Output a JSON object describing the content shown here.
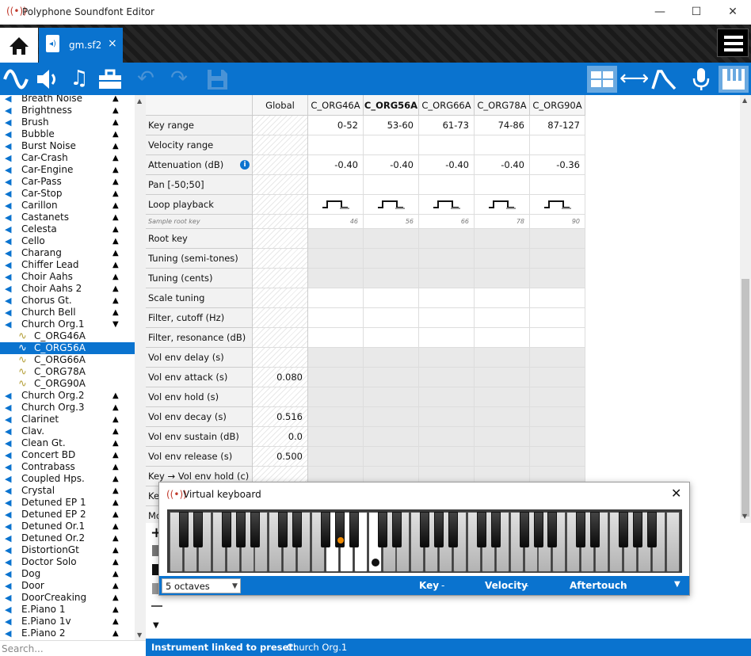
{
  "window": {
    "title": "Polyphone Soundfont Editor",
    "minimize": "—",
    "maximize": "☐",
    "close": "✕"
  },
  "tabs": {
    "file_name": "gm.sf2",
    "close": "×"
  },
  "tree": {
    "items": [
      {
        "label": "Breath Noise",
        "type": "preset",
        "arrow": "▲"
      },
      {
        "label": "Brightness",
        "type": "preset",
        "arrow": "▲"
      },
      {
        "label": "Brush",
        "type": "preset",
        "arrow": "▲"
      },
      {
        "label": "Bubble",
        "type": "preset",
        "arrow": "▲"
      },
      {
        "label": "Burst Noise",
        "type": "preset",
        "arrow": "▲"
      },
      {
        "label": "Car-Crash",
        "type": "preset",
        "arrow": "▲"
      },
      {
        "label": "Car-Engine",
        "type": "preset",
        "arrow": "▲"
      },
      {
        "label": "Car-Pass",
        "type": "preset",
        "arrow": "▲"
      },
      {
        "label": "Car-Stop",
        "type": "preset",
        "arrow": "▲"
      },
      {
        "label": "Carillon",
        "type": "preset",
        "arrow": "▲"
      },
      {
        "label": "Castanets",
        "type": "preset",
        "arrow": "▲"
      },
      {
        "label": "Celesta",
        "type": "preset",
        "arrow": "▲"
      },
      {
        "label": "Cello",
        "type": "preset",
        "arrow": "▲"
      },
      {
        "label": "Charang",
        "type": "preset",
        "arrow": "▲"
      },
      {
        "label": "Chiffer Lead",
        "type": "preset",
        "arrow": "▲"
      },
      {
        "label": "Choir Aahs",
        "type": "preset",
        "arrow": "▲"
      },
      {
        "label": "Choir Aahs 2",
        "type": "preset",
        "arrow": "▲"
      },
      {
        "label": "Chorus Gt.",
        "type": "preset",
        "arrow": "▲"
      },
      {
        "label": "Church Bell",
        "type": "preset",
        "arrow": "▲"
      },
      {
        "label": "Church Org.1",
        "type": "preset",
        "arrow": "▼"
      },
      {
        "label": "C_ORG46A",
        "type": "sample",
        "arrow": ""
      },
      {
        "label": "C_ORG56A",
        "type": "sample",
        "arrow": "",
        "selected": true
      },
      {
        "label": "C_ORG66A",
        "type": "sample",
        "arrow": ""
      },
      {
        "label": "C_ORG78A",
        "type": "sample",
        "arrow": ""
      },
      {
        "label": "C_ORG90A",
        "type": "sample",
        "arrow": ""
      },
      {
        "label": "Church Org.2",
        "type": "preset",
        "arrow": "▲"
      },
      {
        "label": "Church Org.3",
        "type": "preset",
        "arrow": "▲"
      },
      {
        "label": "Clarinet",
        "type": "preset",
        "arrow": "▲"
      },
      {
        "label": "Clav.",
        "type": "preset",
        "arrow": "▲"
      },
      {
        "label": "Clean Gt.",
        "type": "preset",
        "arrow": "▲"
      },
      {
        "label": "Concert BD",
        "type": "preset",
        "arrow": "▲"
      },
      {
        "label": "Contrabass",
        "type": "preset",
        "arrow": "▲"
      },
      {
        "label": "Coupled Hps.",
        "type": "preset",
        "arrow": "▲"
      },
      {
        "label": "Crystal",
        "type": "preset",
        "arrow": "▲"
      },
      {
        "label": "Detuned EP 1",
        "type": "preset",
        "arrow": "▲"
      },
      {
        "label": "Detuned EP 2",
        "type": "preset",
        "arrow": "▲"
      },
      {
        "label": "Detuned Or.1",
        "type": "preset",
        "arrow": "▲"
      },
      {
        "label": "Detuned Or.2",
        "type": "preset",
        "arrow": "▲"
      },
      {
        "label": "DistortionGt",
        "type": "preset",
        "arrow": "▲"
      },
      {
        "label": "Doctor Solo",
        "type": "preset",
        "arrow": "▲"
      },
      {
        "label": "Dog",
        "type": "preset",
        "arrow": "▲"
      },
      {
        "label": "Door",
        "type": "preset",
        "arrow": "▲"
      },
      {
        "label": "DoorCreaking",
        "type": "preset",
        "arrow": "▲"
      },
      {
        "label": "E.Piano 1",
        "type": "preset",
        "arrow": "▲"
      },
      {
        "label": "E.Piano 1v",
        "type": "preset",
        "arrow": "▲"
      },
      {
        "label": "E.Piano 2",
        "type": "preset",
        "arrow": "▲"
      }
    ],
    "search_placeholder": "Search..."
  },
  "table": {
    "columns": [
      "Global",
      "C_ORG46A",
      "C_ORG56A",
      "C_ORG66A",
      "C_ORG78A",
      "C_ORG90A"
    ],
    "bold_column": 2,
    "rows": [
      {
        "label": "Key range",
        "values": [
          "",
          "0-52",
          "53-60",
          "61-73",
          "74-86",
          "87-127"
        ],
        "style": "white"
      },
      {
        "label": "Velocity range",
        "values": [
          "",
          "",
          "",
          "",
          "",
          ""
        ],
        "style": "white"
      },
      {
        "label": "Attenuation (dB)",
        "values": [
          "",
          "-0.40",
          "-0.40",
          "-0.40",
          "-0.40",
          "-0.36"
        ],
        "style": "white",
        "info": true
      },
      {
        "label": "Pan [-50;50]",
        "values": [
          "",
          "",
          "",
          "",
          "",
          ""
        ],
        "style": "white"
      },
      {
        "label": "Loop playback",
        "values": [
          "",
          "",
          "",
          "",
          "",
          ""
        ],
        "style": "white",
        "loop": true
      },
      {
        "label": "Sample root key",
        "values": [
          "",
          "46",
          "56",
          "66",
          "78",
          "90"
        ],
        "style": "small"
      },
      {
        "label": "Root key",
        "values": [
          "",
          "",
          "",
          "",
          "",
          ""
        ],
        "style": "gray"
      },
      {
        "label": "Tuning (semi-tones)",
        "values": [
          "",
          "",
          "",
          "",
          "",
          ""
        ],
        "style": "gray"
      },
      {
        "label": "Tuning (cents)",
        "values": [
          "",
          "",
          "",
          "",
          "",
          ""
        ],
        "style": "gray"
      },
      {
        "label": "Scale tuning",
        "values": [
          "",
          "",
          "",
          "",
          "",
          ""
        ],
        "style": "white"
      },
      {
        "label": "Filter, cutoff (Hz)",
        "values": [
          "",
          "",
          "",
          "",
          "",
          ""
        ],
        "style": "white"
      },
      {
        "label": "Filter, resonance (dB)",
        "values": [
          "",
          "",
          "",
          "",
          "",
          ""
        ],
        "style": "white"
      },
      {
        "label": "Vol env delay (s)",
        "values": [
          "",
          "",
          "",
          "",
          "",
          ""
        ],
        "style": "gray"
      },
      {
        "label": "Vol env attack (s)",
        "values": [
          "0.080",
          "",
          "",
          "",
          "",
          ""
        ],
        "style": "gray"
      },
      {
        "label": "Vol env hold (s)",
        "values": [
          "",
          "",
          "",
          "",
          "",
          ""
        ],
        "style": "gray"
      },
      {
        "label": "Vol env decay (s)",
        "values": [
          "0.516",
          "",
          "",
          "",
          "",
          ""
        ],
        "style": "gray"
      },
      {
        "label": "Vol env sustain (dB)",
        "values": [
          "0.0",
          "",
          "",
          "",
          "",
          ""
        ],
        "style": "gray"
      },
      {
        "label": "Vol env release (s)",
        "values": [
          "0.500",
          "",
          "",
          "",
          "",
          ""
        ],
        "style": "gray"
      },
      {
        "label": "Key → Vol env hold (c)",
        "values": [
          "",
          "",
          "",
          "",
          "",
          ""
        ],
        "style": "gray"
      },
      {
        "label": "Ke",
        "values": [
          "",
          "",
          "",
          "",
          "",
          ""
        ],
        "style": "gray"
      },
      {
        "label": "Mo",
        "values": [
          "",
          "",
          "",
          "",
          "",
          ""
        ],
        "style": "gray"
      }
    ]
  },
  "status": {
    "label": "Instrument linked to preset:",
    "value": "Church Org.1"
  },
  "virtual_keyboard": {
    "title": "Virtual keyboard",
    "close": "✕",
    "octaves": "5 octaves",
    "key_label": "Key",
    "key_value": "-",
    "velocity_label": "Velocity",
    "velocity_value": "-",
    "aftertouch_label": "Aftertouch",
    "aftertouch_value": "-",
    "menu_arrow": "▼"
  },
  "colors": {
    "accent": "#0a73cf",
    "selected": "#0a73cf",
    "marker": "#f08a00"
  }
}
